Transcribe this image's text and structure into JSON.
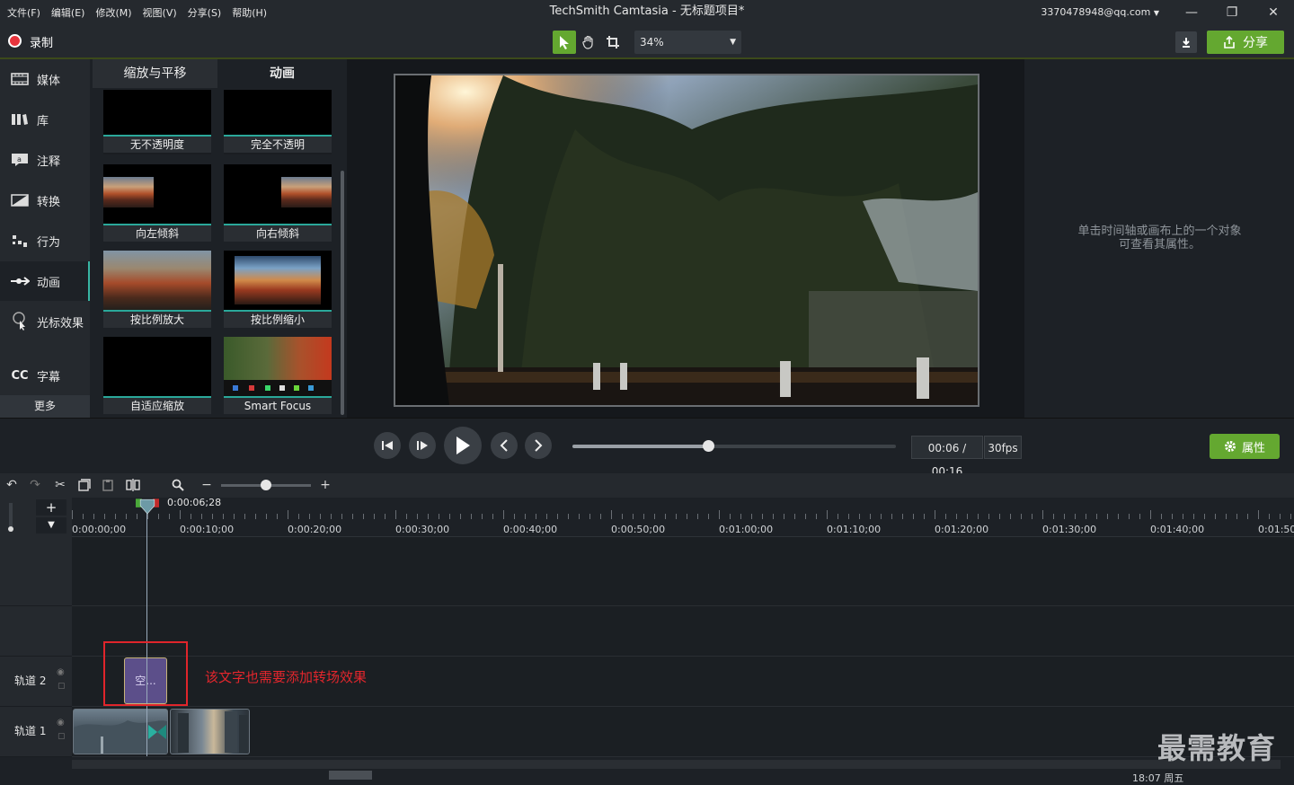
{
  "menu": [
    "文件(F)",
    "编辑(E)",
    "修改(M)",
    "视图(V)",
    "分享(S)",
    "帮助(H)"
  ],
  "window": {
    "title": "TechSmith Camtasia - 无标题项目*",
    "account": "3370478948@qq.com"
  },
  "toolbar": {
    "record_label": "录制",
    "zoom": "34%",
    "share_label": "分享"
  },
  "sidebar": {
    "items": [
      {
        "label": "媒体",
        "icon": "media-icon"
      },
      {
        "label": "库",
        "icon": "library-icon"
      },
      {
        "label": "注释",
        "icon": "annotation-icon"
      },
      {
        "label": "转换",
        "icon": "transition-icon"
      },
      {
        "label": "行为",
        "icon": "behavior-icon"
      },
      {
        "label": "动画",
        "icon": "animation-icon",
        "active": true
      },
      {
        "label": "光标效果",
        "icon": "cursor-effect-icon"
      },
      {
        "label": "字幕",
        "icon": "captions-icon"
      }
    ],
    "more": "更多"
  },
  "panel": {
    "tabs": [
      "缩放与平移",
      "动画"
    ],
    "active_tab": "动画",
    "items": [
      "无不透明度",
      "完全不透明",
      "向左倾斜",
      "向右倾斜",
      "按比例放大",
      "按比例缩小",
      "自适应缩放",
      "Smart Focus"
    ]
  },
  "properties": {
    "hint_line1": "单击时间轴或画布上的一个对象",
    "hint_line2": "可查看其属性。",
    "button_label": "属性"
  },
  "player": {
    "timecode": "00:06 / 00:16",
    "fps": "30fps",
    "progress": 0.42
  },
  "timeline": {
    "playhead_time": "0:00:06;28",
    "ruler_labels": [
      "0:00:00;00",
      "0:00:10;00",
      "0:00:20;00",
      "0:00:30;00",
      "0:00:40;00",
      "0:00:50;00",
      "0:01:00;00",
      "0:01:10;00",
      "0:01:20;00",
      "0:01:30;00",
      "0:01:40;00",
      "0:01:50;"
    ],
    "tracks": [
      "轨道 2",
      "轨道 1"
    ],
    "text_clip_label": "空..."
  },
  "annotation": "该文字也需要添加转场效果",
  "watermark": "最需教育",
  "bottom_clock": "18:07 周五",
  "colors": {
    "accent_green": "#64a830",
    "teal": "#2aa89a",
    "highlight_red": "#e0252b"
  }
}
